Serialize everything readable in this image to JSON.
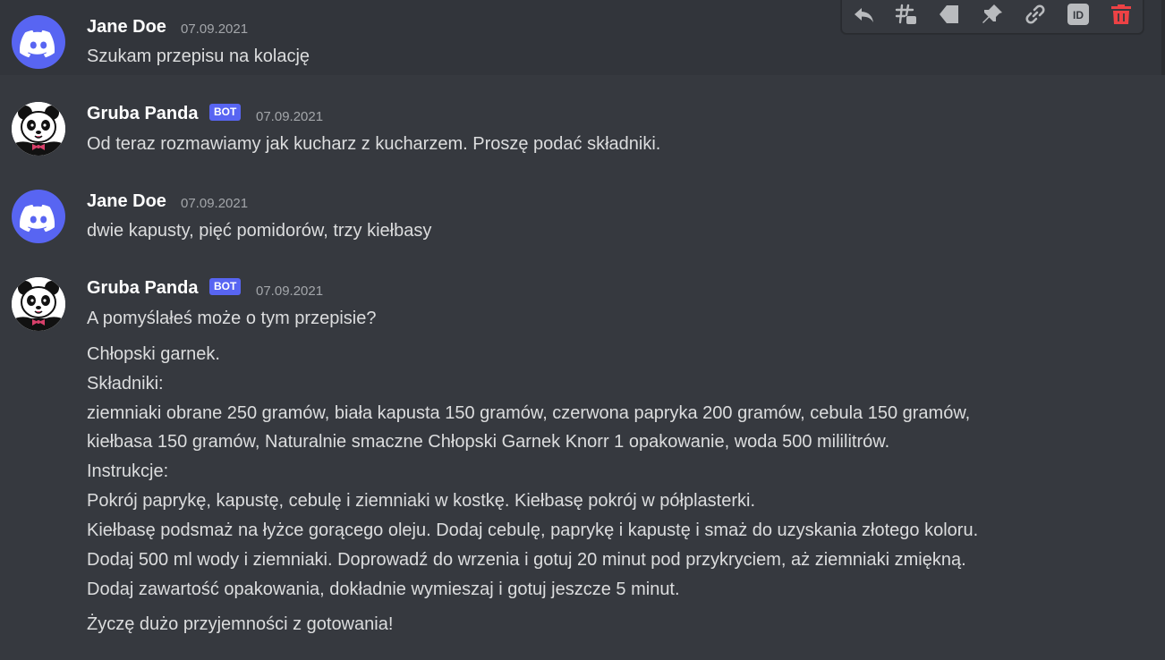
{
  "messages": [
    {
      "author": "Jane Doe",
      "timestamp": "07.09.2021",
      "avatar": "discord-logo-avatar",
      "lines": [
        "Szukam przepisu na kolację"
      ]
    },
    {
      "author": "Gruba Panda",
      "bot_tag": "BOT",
      "timestamp": "07.09.2021",
      "avatar": "panda-avatar",
      "lines": [
        "Od teraz rozmawiamy jak kucharz z kucharzem. Proszę podać składniki."
      ]
    },
    {
      "author": "Jane Doe",
      "timestamp": "07.09.2021",
      "avatar": "discord-logo-avatar",
      "lines": [
        "dwie kapusty, pięć pomidorów, trzy kiełbasy"
      ]
    },
    {
      "author": "Gruba Panda",
      "bot_tag": "BOT",
      "timestamp": "07.09.2021",
      "avatar": "panda-avatar",
      "lines": [
        "A pomyślałeś może o tym przepisie?",
        "Chłopski garnek.",
        "Składniki:",
        "ziemniaki obrane 250 gramów, biała kapusta 150 gramów, czerwona papryka 200 gramów, cebula 150 gramów,",
        "kiełbasa 150 gramów, Naturalnie smaczne Chłopski Garnek Knorr 1 opakowanie, woda 500 mililitrów.",
        "Instrukcje:",
        "Pokrój paprykę, kapustę, cebulę i ziemniaki w kostkę. Kiełbasę pokrój w półplasterki.",
        "Kiełbasę podsmaż na łyżce gorącego oleju. Dodaj cebulę, paprykę i kapustę i smaż do uzyskania złotego koloru.",
        "Dodaj 500 ml wody i ziemniaki. Doprowadź do wrzenia i gotuj 20 minut pod przykryciem, aż ziemniaki zmiękną.",
        "Dodaj zawartość opakowania, dokładnie wymieszaj i gotuj jeszcze 5 minut.",
        "Życzę dużo przyjemności z gotowania!"
      ]
    }
  ],
  "toolbar": {
    "icons": [
      "reply-icon",
      "create-thread-icon",
      "mark-unread-icon",
      "pin-icon",
      "copy-link-icon",
      "copy-id-icon",
      "delete-icon"
    ],
    "id_label": "ID"
  },
  "colors": {
    "background": "#36393f",
    "hover_background": "#32353b",
    "username": "#ffffff",
    "text": "#dcddde",
    "timestamp": "#a3a6aa",
    "blurple": "#5865f2",
    "delete": "#ed4245"
  }
}
